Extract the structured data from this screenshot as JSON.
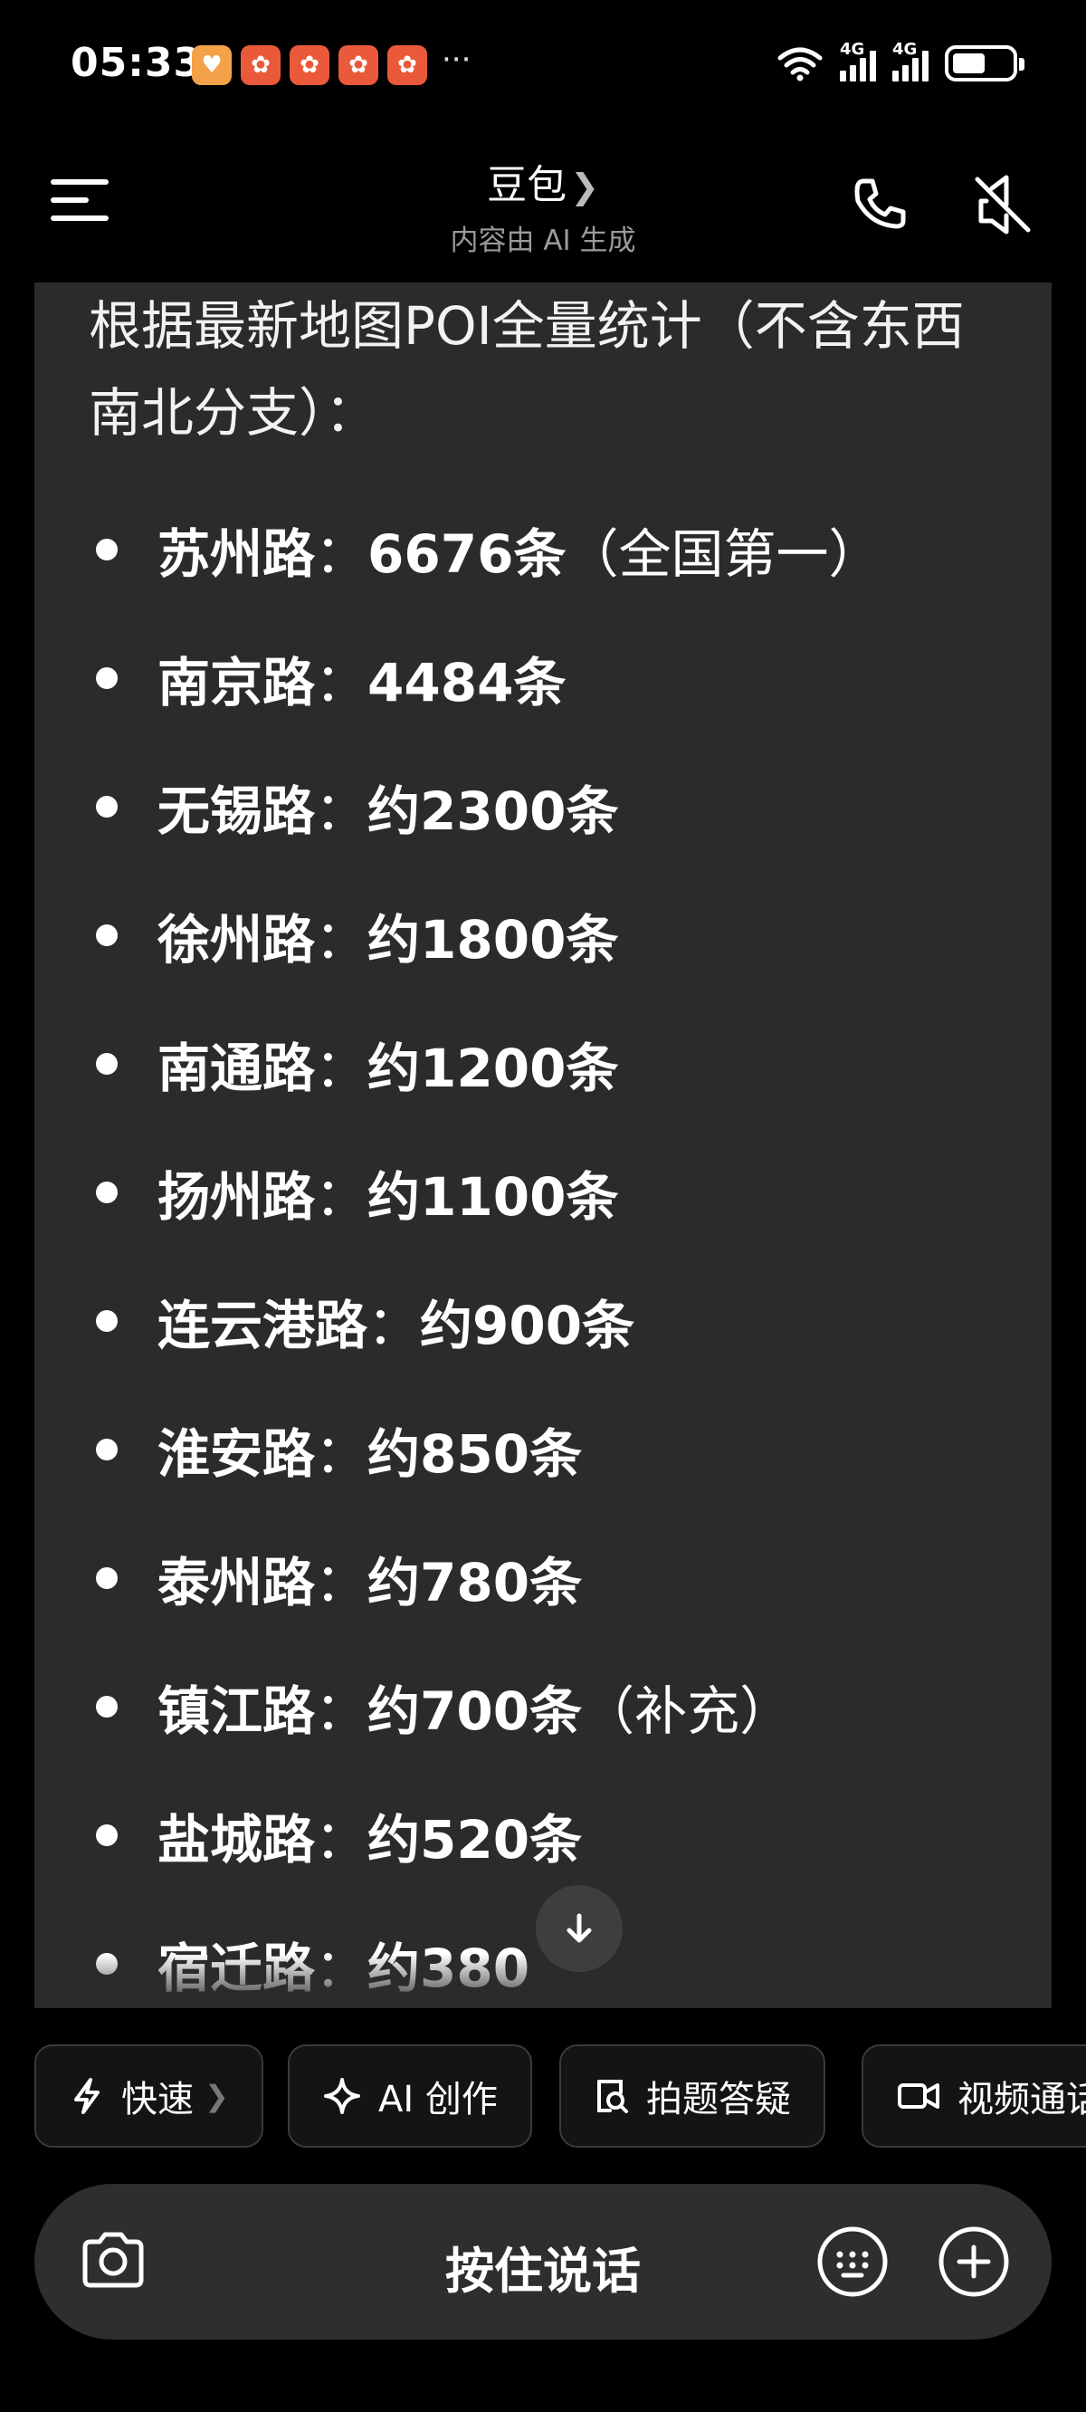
{
  "status_bar": {
    "time": "05:33",
    "more": "···",
    "network_1": "4G",
    "network_2": "4G",
    "battery_level": 0.55
  },
  "header": {
    "title": "豆包",
    "title_chevron": "❯",
    "subtitle": "内容由 AI 生成"
  },
  "message": {
    "intro": "根据最新地图POI全量统计（不含东西南北分支）：",
    "items": [
      {
        "road": "苏州路",
        "sep": "：",
        "count": "6676条",
        "note": "（全国第一）"
      },
      {
        "road": "南京路",
        "sep": "：",
        "count": "4484条",
        "note": ""
      },
      {
        "road": "无锡路",
        "sep": "：",
        "count": "约2300条",
        "note": ""
      },
      {
        "road": "徐州路",
        "sep": "：",
        "count": "约1800条",
        "note": ""
      },
      {
        "road": "南通路",
        "sep": "：",
        "count": "约1200条",
        "note": ""
      },
      {
        "road": "扬州路",
        "sep": "：",
        "count": "约1100条",
        "note": ""
      },
      {
        "road": "连云港路",
        "sep": "：",
        "count": "约900条",
        "note": ""
      },
      {
        "road": "淮安路",
        "sep": "：",
        "count": "约850条",
        "note": ""
      },
      {
        "road": "泰州路",
        "sep": "：",
        "count": "约780条",
        "note": ""
      },
      {
        "road": "镇江路",
        "sep": "：",
        "count": "约700条",
        "note": "（补充）"
      },
      {
        "road": "盐城路",
        "sep": "：",
        "count": "约520条",
        "note": ""
      },
      {
        "road": "宿迁路",
        "sep": "：",
        "count": "约380",
        "note": ""
      }
    ]
  },
  "quick_actions": [
    {
      "label": "快速",
      "icon": "lightning-icon",
      "chevron": "❯"
    },
    {
      "label": "AI 创作",
      "icon": "sparkle-icon"
    },
    {
      "label": "拍题答疑",
      "icon": "photo-search-icon"
    },
    {
      "label": "视频通话",
      "icon": "video-icon"
    }
  ],
  "input_bar": {
    "talk_label": "按住说话"
  },
  "colors": {
    "background": "#000000",
    "card": "#2b2b2b",
    "input_bar": "#2e2e2e",
    "subtitle": "#9a9a9a"
  }
}
